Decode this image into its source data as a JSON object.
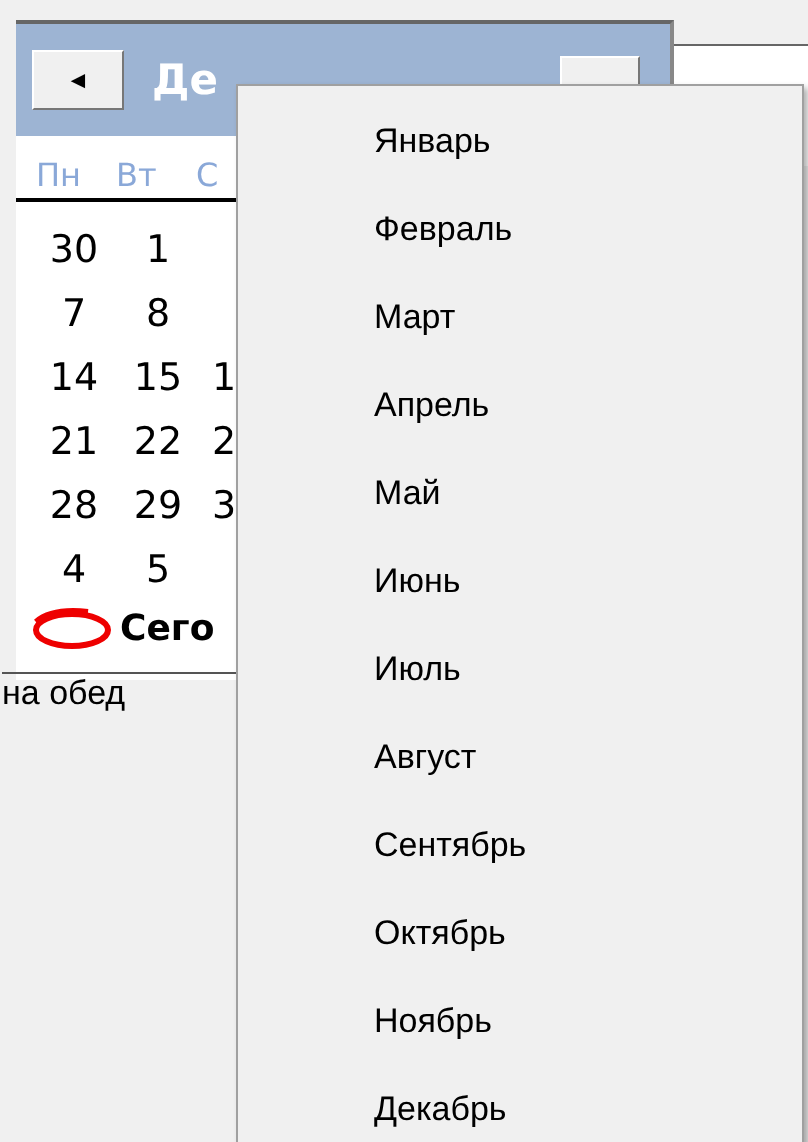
{
  "calendar": {
    "title": "Де",
    "prev_button": "◄",
    "weekdays": [
      "Пн",
      "Вт",
      "С"
    ],
    "weeks": [
      [
        "30",
        "1"
      ],
      [
        "7",
        "8"
      ],
      [
        "14",
        "15",
        "1"
      ],
      [
        "21",
        "22",
        "2"
      ],
      [
        "28",
        "29",
        "3"
      ],
      [
        "4",
        "5"
      ]
    ],
    "today_label": "Сего"
  },
  "note": "на обед",
  "month_menu": {
    "items": [
      {
        "label": "Январь"
      },
      {
        "label": "Февраль"
      },
      {
        "label": "Март"
      },
      {
        "label": "Апрель"
      },
      {
        "label": "Май"
      },
      {
        "label": "Июнь"
      },
      {
        "label": "Июль"
      },
      {
        "label": "Август"
      },
      {
        "label": "Сентябрь"
      },
      {
        "label": "Октябрь"
      },
      {
        "label": "Ноябрь"
      },
      {
        "label": "Декабрь"
      }
    ]
  }
}
